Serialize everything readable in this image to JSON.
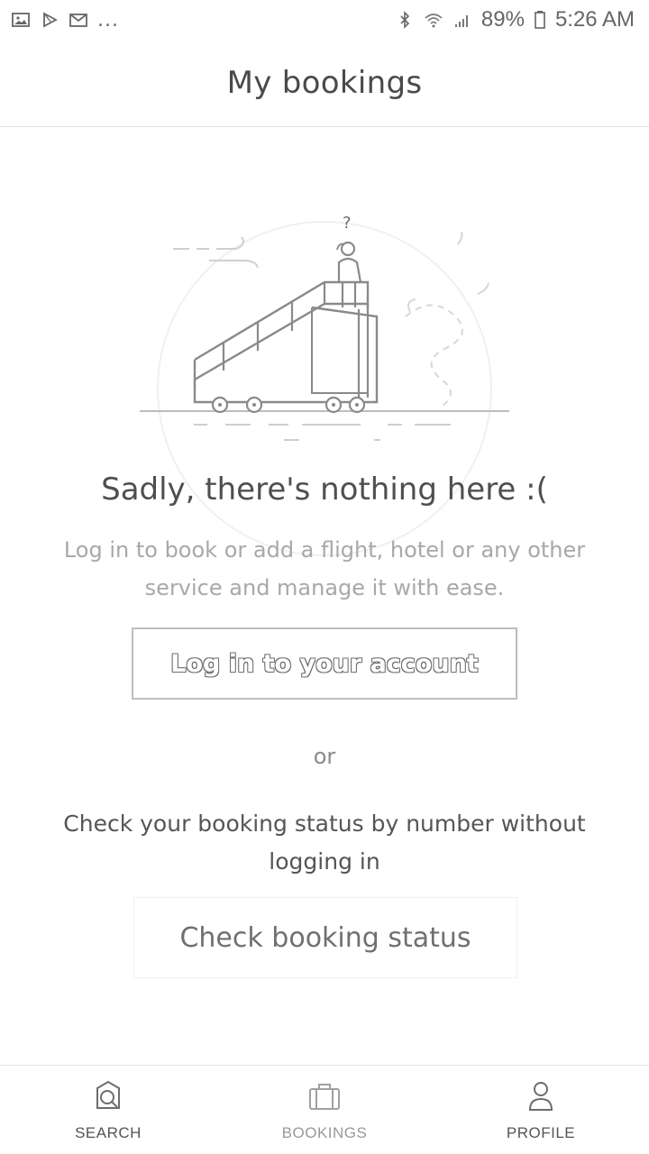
{
  "statusbar": {
    "battery": "89%",
    "time": "5:26 AM",
    "left_icons": [
      "gallery-icon",
      "play-store-icon",
      "gmail-icon"
    ],
    "right_icons": [
      "bluetooth-icon",
      "wifi-icon",
      "signal-icon",
      "battery-icon"
    ],
    "more": "..."
  },
  "header": {
    "title": "My bookings"
  },
  "empty_state": {
    "illustration": "airplane-stairs-illustration",
    "question_mark": "?",
    "headline": "Sadly, there's nothing here :(",
    "subtext": "Log in to book or add a flight, hotel or any other service and manage it with ease.",
    "login_button": "Log in to your account",
    "or_text": "or",
    "check_text": "Check your booking status by number without logging in",
    "check_button": "Check booking status"
  },
  "tabs": [
    {
      "label": "SEARCH",
      "icon": "search-icon",
      "active": false
    },
    {
      "label": "BOOKINGS",
      "icon": "suitcase-icon",
      "active": true
    },
    {
      "label": "PROFILE",
      "icon": "profile-icon",
      "active": false
    }
  ],
  "colors": {
    "text": "#555555",
    "muted": "#a8a8a8",
    "border": "#bdbdbd",
    "background": "#ffffff"
  }
}
